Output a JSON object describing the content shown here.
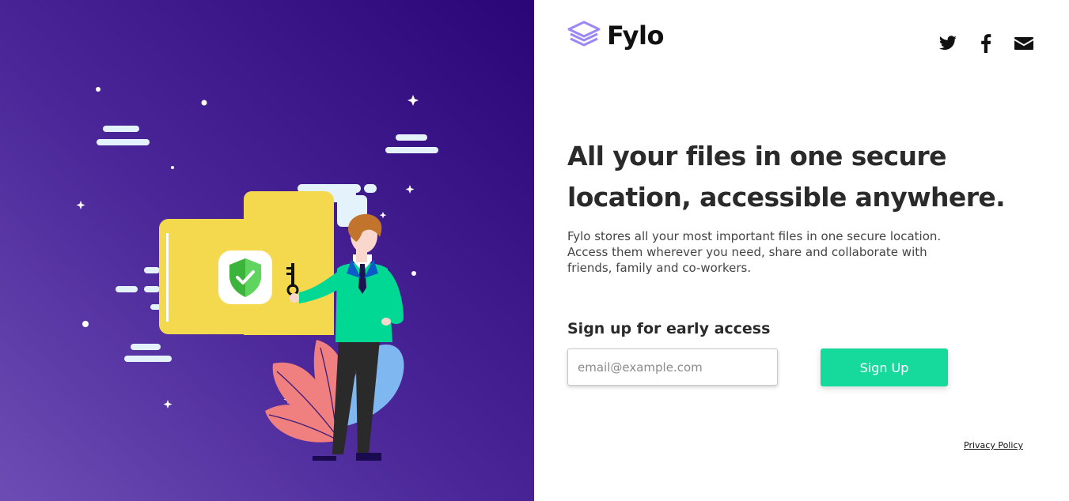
{
  "brand": {
    "name": "Fylo",
    "logo_icon": "stacked-layers-icon",
    "logo_color": "#9b87f5"
  },
  "social": [
    {
      "name": "twitter-icon"
    },
    {
      "name": "facebook-icon"
    },
    {
      "name": "email-icon"
    }
  ],
  "hero": {
    "headline_line1": "All your files in one secure",
    "headline_line2": "location, accessible anywhere.",
    "description": "Fylo stores all your most important files in one secure location. Access them wherever you need, share and collaborate with friends, family and co-workers."
  },
  "signup": {
    "heading": "Sign up for early access",
    "email_placeholder": "email@example.com",
    "email_value": "",
    "button_label": "Sign Up"
  },
  "footer": {
    "privacy_label": "Privacy Policy"
  },
  "colors": {
    "accent": "#16d99c",
    "left_gradient_top": "#2a0578",
    "left_gradient_bottom": "#6d4db4",
    "heading_text": "#2a2a2a"
  },
  "illustration": {
    "name": "secure-folder-illustration",
    "elements": [
      "folder-icon",
      "shield-check-icon",
      "key-icon",
      "person-figure",
      "leaf-plants",
      "clouds",
      "stars"
    ]
  }
}
